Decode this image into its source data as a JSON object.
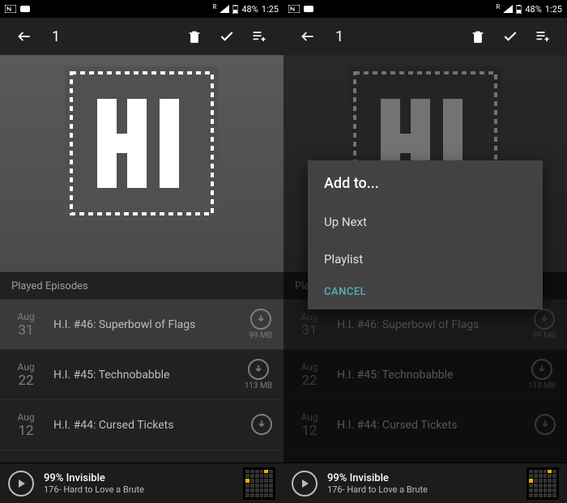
{
  "status": {
    "battery": "48%",
    "time": "1:25",
    "net_sup": "R"
  },
  "toolbar": {
    "selected_count": "1"
  },
  "section": {
    "played_header": "Played Episodes"
  },
  "episodes": [
    {
      "month": "Aug",
      "day": "31",
      "title": "H.I. #46: Superbowl of Flags",
      "size": "99 MB"
    },
    {
      "month": "Aug",
      "day": "22",
      "title": "H.I. #45: Technobabble",
      "size": "113 MB"
    },
    {
      "month": "Aug",
      "day": "12",
      "title": "H.I. #44: Cursed Tickets",
      "size": ""
    }
  ],
  "now_playing": {
    "show": "99% Invisible",
    "episode": "176- Hard to Love a Brute"
  },
  "dialog": {
    "title": "Add to...",
    "options": [
      "Up Next",
      "Playlist"
    ],
    "cancel": "CANCEL"
  }
}
